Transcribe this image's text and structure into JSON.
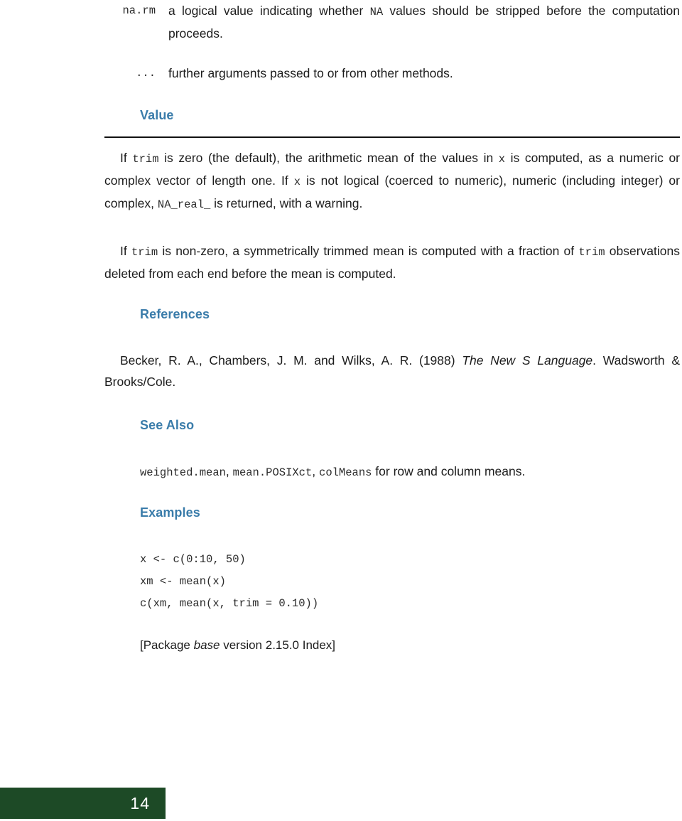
{
  "document": {
    "type": "r-manual-page",
    "page_number": "14",
    "package_footer": {
      "prefix": "[Package ",
      "package": "base",
      "middle": " version ",
      "version": "2.15.0",
      "suffix": " Index]"
    },
    "colors": {
      "heading_blue": "#3a7caa",
      "page_bar_green": "#1d4a26",
      "body_text": "#1c1c1c",
      "mono_text": "#2b2b2b",
      "rule": "#111111"
    }
  },
  "arguments": [
    {
      "term": "na.rm",
      "desc_parts": [
        {
          "type": "text",
          "text": "a logical value indicating whether "
        },
        {
          "type": "code",
          "text": "NA"
        },
        {
          "type": "text",
          "text": " values should be stripped before the computation proceeds."
        }
      ],
      "desc_plain": "a logical value indicating whether NA values should be stripped before the computation proceeds."
    },
    {
      "term": "...",
      "desc_parts": [
        {
          "type": "text",
          "text": "further arguments passed to or from other methods."
        }
      ],
      "desc_plain": "further arguments passed to or from other methods."
    }
  ],
  "sections": [
    {
      "id": "value",
      "heading": "Value",
      "has_rule": true,
      "paragraphs": [
        {
          "id": "value-p1",
          "plain": "If trim is zero (the default), the arithmetic mean of the values in x is computed, as a numeric or complex vector of length one. If x is not logical (coerced to numeric), numeric (including integer) or complex, NA_real_ is returned, with a warning.",
          "parts": [
            {
              "type": "text",
              "text": "If "
            },
            {
              "type": "code",
              "text": "trim"
            },
            {
              "type": "text",
              "text": " is zero (the default), the arithmetic mean of the values in "
            },
            {
              "type": "code",
              "text": "x"
            },
            {
              "type": "text",
              "text": " is computed, as a numeric or complex vector of length one. If "
            },
            {
              "type": "code",
              "text": "x"
            },
            {
              "type": "text",
              "text": " is not logical (coerced to numeric), numeric (including integer) or complex, "
            },
            {
              "type": "code",
              "text": "NA_real_"
            },
            {
              "type": "text",
              "text": " is returned, with a warning."
            }
          ]
        },
        {
          "id": "value-p2",
          "plain": "If trim is non-zero, a symmetrically trimmed mean is computed with a fraction of trim observations deleted from each end before the mean is computed.",
          "parts": [
            {
              "type": "text",
              "text": "If "
            },
            {
              "type": "code",
              "text": "trim"
            },
            {
              "type": "text",
              "text": " is non-zero, a symmetrically trimmed mean is computed with a fraction of "
            },
            {
              "type": "code",
              "text": "trim"
            },
            {
              "type": "text",
              "text": " observations deleted from each end before the mean is computed."
            }
          ]
        }
      ]
    },
    {
      "id": "references",
      "heading": "References",
      "has_rule": false,
      "paragraphs": [
        {
          "id": "references-p1",
          "plain": "Becker, R. A., Chambers, J. M. and Wilks, A. R. (1988) The New S Language. Wadsworth & Brooks/Cole.",
          "parts": [
            {
              "type": "text",
              "text": "Becker, R. A., Chambers, J. M. and Wilks, A. R. (1988) "
            },
            {
              "type": "italic",
              "text": "The New S Language"
            },
            {
              "type": "text",
              "text": ". Wadsworth & Brooks/Cole."
            }
          ]
        }
      ]
    },
    {
      "id": "see-also",
      "heading": "See Also",
      "has_rule": false,
      "paragraphs": [
        {
          "id": "see-also-p1",
          "plain": "weighted.mean, mean.POSIXct, colMeans for row and column means.",
          "parts": [
            {
              "type": "code",
              "text": "weighted.mean"
            },
            {
              "type": "text",
              "text": ", "
            },
            {
              "type": "code",
              "text": "mean.POSIXct"
            },
            {
              "type": "text",
              "text": ", "
            },
            {
              "type": "code",
              "text": "colMeans"
            },
            {
              "type": "text",
              "text": " for row and column means."
            }
          ]
        }
      ]
    },
    {
      "id": "examples",
      "heading": "Examples",
      "has_rule": false,
      "code_lines": [
        "x <- c(0:10, 50)",
        "xm <- mean(x)",
        "c(xm, mean(x, trim = 0.10))"
      ]
    }
  ],
  "see_also_links": [
    "weighted.mean",
    "mean.POSIXct",
    "colMeans"
  ]
}
